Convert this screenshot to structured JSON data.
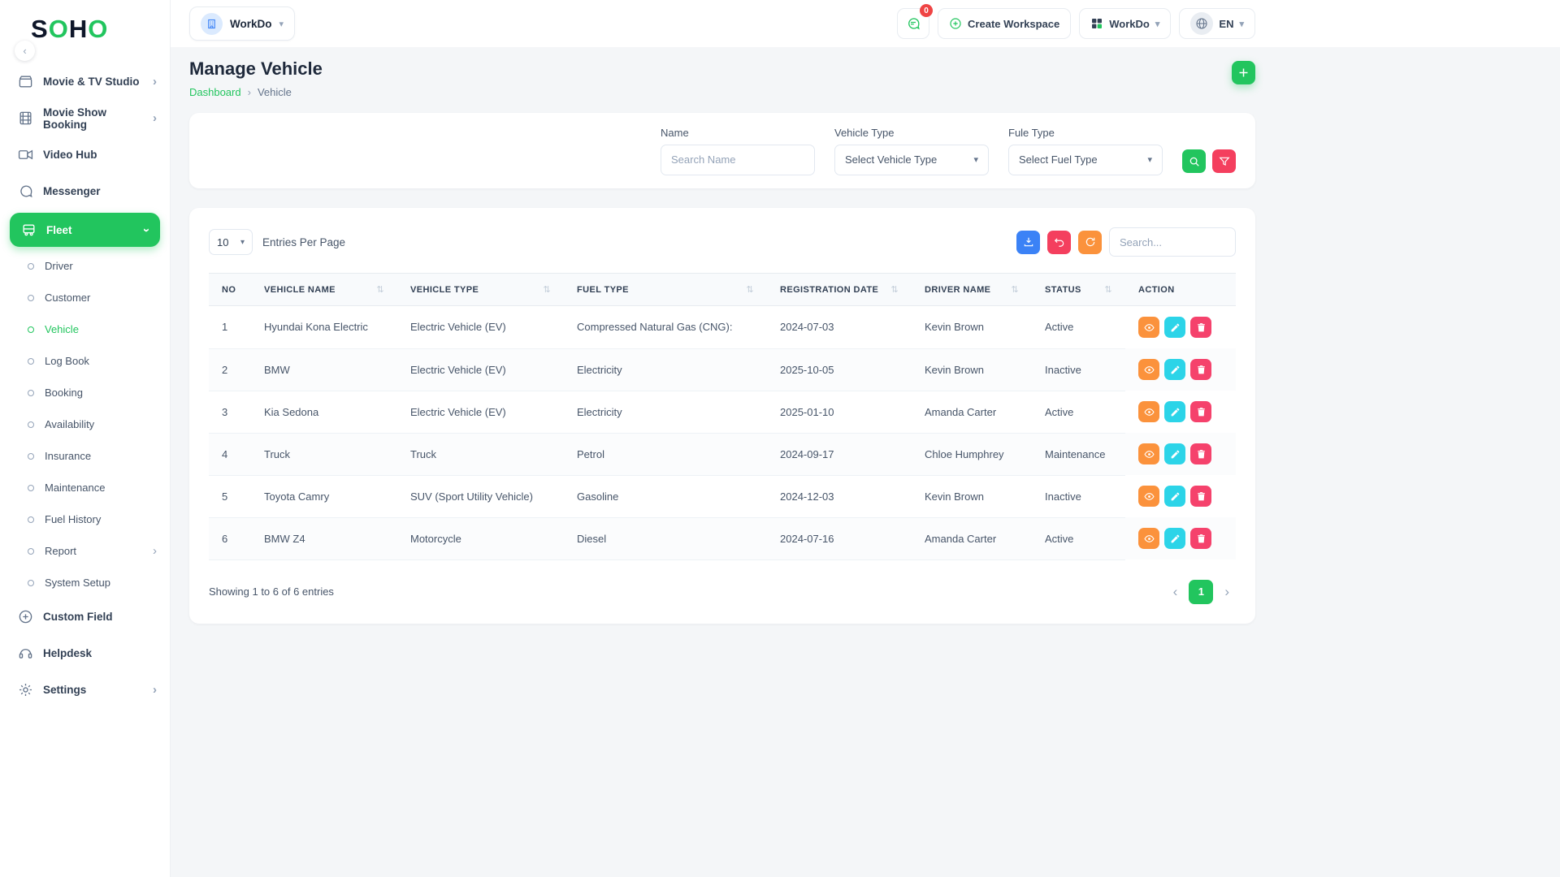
{
  "brand": {
    "logo_parts": [
      "S",
      "O",
      "H",
      "O"
    ]
  },
  "topbar": {
    "workspace_switcher_label": "WorkDo",
    "chat_badge": "0",
    "create_workspace_label": "Create Workspace",
    "apps_button_label": "WorkDo",
    "language": "EN"
  },
  "sidebar": {
    "items": [
      {
        "label": "Movie & TV Studio"
      },
      {
        "label": "Movie Show Booking"
      },
      {
        "label": "Video Hub"
      },
      {
        "label": "Messenger"
      },
      {
        "label": "Fleet"
      },
      {
        "label": "Driver"
      },
      {
        "label": "Customer"
      },
      {
        "label": "Vehicle"
      },
      {
        "label": "Log Book"
      },
      {
        "label": "Booking"
      },
      {
        "label": "Availability"
      },
      {
        "label": "Insurance"
      },
      {
        "label": "Maintenance"
      },
      {
        "label": "Fuel History"
      },
      {
        "label": "Report"
      },
      {
        "label": "System Setup"
      },
      {
        "label": "Custom Field"
      },
      {
        "label": "Helpdesk"
      },
      {
        "label": "Settings"
      }
    ]
  },
  "page": {
    "title": "Manage Vehicle",
    "breadcrumb_home": "Dashboard",
    "breadcrumb_current": "Vehicle"
  },
  "filters": {
    "name_label": "Name",
    "name_placeholder": "Search Name",
    "vehicle_type_label": "Vehicle Type",
    "vehicle_type_value": "Select Vehicle Type",
    "fuel_type_label": "Fule Type",
    "fuel_type_value": "Select Fuel Type"
  },
  "table": {
    "entries_per_page": "10",
    "entries_label": "Entries Per Page",
    "search_placeholder": "Search...",
    "headers": [
      "NO",
      "VEHICLE NAME",
      "VEHICLE TYPE",
      "FUEL TYPE",
      "REGISTRATION DATE",
      "DRIVER NAME",
      "STATUS",
      "ACTION"
    ],
    "rows": [
      {
        "no": "1",
        "name": "Hyundai Kona Electric",
        "type": "Electric Vehicle (EV)",
        "fuel": "Compressed Natural Gas (CNG):",
        "date": "2024-07-03",
        "driver": "Kevin Brown",
        "status": "Active"
      },
      {
        "no": "2",
        "name": "BMW",
        "type": "Electric Vehicle (EV)",
        "fuel": "Electricity",
        "date": "2025-10-05",
        "driver": "Kevin Brown",
        "status": "Inactive"
      },
      {
        "no": "3",
        "name": "Kia Sedona",
        "type": "Electric Vehicle (EV)",
        "fuel": "Electricity",
        "date": "2025-01-10",
        "driver": "Amanda Carter",
        "status": "Active"
      },
      {
        "no": "4",
        "name": "Truck",
        "type": "Truck",
        "fuel": "Petrol",
        "date": "2024-09-17",
        "driver": "Chloe Humphrey",
        "status": "Maintenance"
      },
      {
        "no": "5",
        "name": "Toyota Camry",
        "type": "SUV (Sport Utility Vehicle)",
        "fuel": "Gasoline",
        "date": "2024-12-03",
        "driver": "Kevin Brown",
        "status": "Inactive"
      },
      {
        "no": "6",
        "name": "BMW Z4",
        "type": "Motorcycle",
        "fuel": "Diesel",
        "date": "2024-07-16",
        "driver": "Amanda Carter",
        "status": "Active"
      }
    ],
    "footer_text": "Showing 1 to 6 of 6 entries",
    "current_page": "1"
  },
  "colors": {
    "accent_green": "#22c55e",
    "view_orange": "#fb923c",
    "edit_cyan": "#2cd4e8",
    "delete_rose": "#f5426c",
    "download_blue": "#3b82f6",
    "badge_red": "#ef4444"
  }
}
